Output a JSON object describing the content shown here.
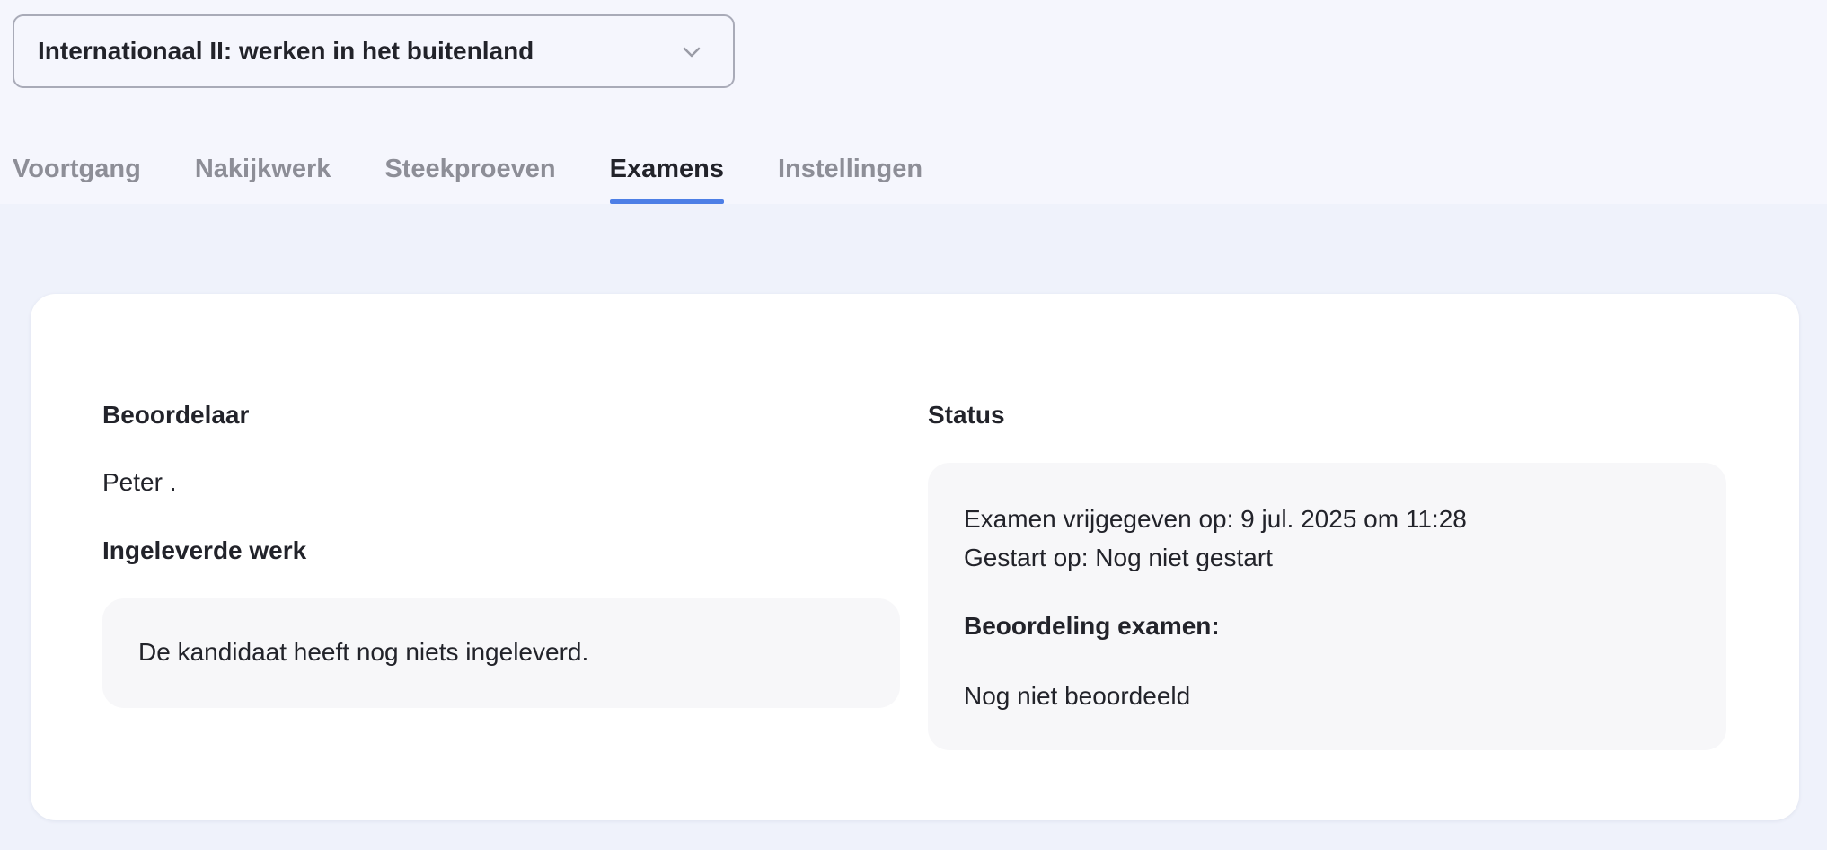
{
  "course_select": {
    "value": "Internationaal II: werken in het buitenland",
    "icon": "chevron-down-icon"
  },
  "tabs": [
    {
      "label": "Voortgang",
      "active": false
    },
    {
      "label": "Nakijkwerk",
      "active": false
    },
    {
      "label": "Steekproeven",
      "active": false
    },
    {
      "label": "Examens",
      "active": true
    },
    {
      "label": "Instellingen",
      "active": false
    }
  ],
  "card": {
    "assessor_heading": "Beoordelaar",
    "assessor_name": "Peter .",
    "submitted_heading": "Ingeleverde werk",
    "submitted_text": "De kandidaat heeft nog niets ingeleverd.",
    "status_heading": "Status",
    "status": {
      "released": "Examen vrijgegeven op: 9 jul. 2025 om 11:28",
      "started": "Gestart op: Nog niet gestart",
      "grade_heading": "Beoordeling examen:",
      "grade_value": "Nog niet beoordeeld"
    }
  },
  "colors": {
    "accent": "#4d7fe6",
    "page_background": "#eff2fb",
    "header_background": "#f5f6fd",
    "panel_background": "#f7f7f9"
  }
}
